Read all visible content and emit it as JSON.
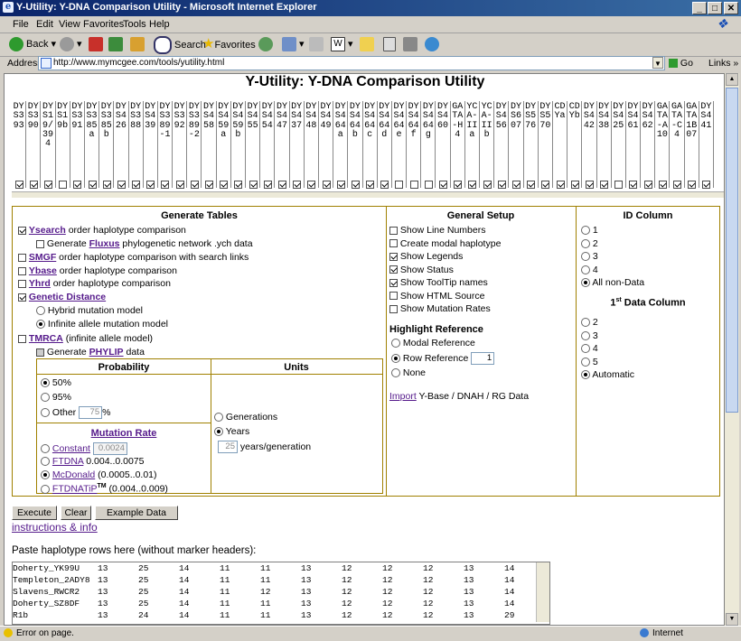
{
  "window": {
    "title": "Y-Utility: Y-DNA Comparison Utility - Microsoft Internet Explorer"
  },
  "menu": [
    "File",
    "Edit",
    "View",
    "Favorites",
    "Tools",
    "Help"
  ],
  "toolbar": {
    "back": "Back",
    "search": "Search",
    "favorites": "Favorites"
  },
  "address": {
    "label": "Address",
    "url": "http://www.mymcgee.com/tools/yutility.html",
    "go": "Go",
    "links": "Links"
  },
  "page": {
    "title": "Y-Utility: Y-DNA Comparison Utility"
  },
  "markers": [
    {
      "label": "DYS393",
      "on": true
    },
    {
      "label": "DYS390",
      "on": true
    },
    {
      "label": "DYS19/394",
      "on": true
    },
    {
      "label": "DYS19b",
      "on": false
    },
    {
      "label": "DYS391",
      "on": true
    },
    {
      "label": "DYS385a",
      "on": true
    },
    {
      "label": "DYS385b",
      "on": true
    },
    {
      "label": "DYS426",
      "on": true
    },
    {
      "label": "DYS388",
      "on": true
    },
    {
      "label": "DYS439",
      "on": true
    },
    {
      "label": "DYS389-1",
      "on": true
    },
    {
      "label": "DYS392",
      "on": true
    },
    {
      "label": "DYS389-2",
      "on": true
    },
    {
      "label": "DYS458",
      "on": true
    },
    {
      "label": "DYS459a",
      "on": true
    },
    {
      "label": "DYS459b",
      "on": true
    },
    {
      "label": "DYS455",
      "on": true
    },
    {
      "label": "DYS454",
      "on": true
    },
    {
      "label": "DYS447",
      "on": true
    },
    {
      "label": "DYS437",
      "on": true
    },
    {
      "label": "DYS448",
      "on": true
    },
    {
      "label": "DYS449",
      "on": true
    },
    {
      "label": "DYS464a",
      "on": true
    },
    {
      "label": "DYS464b",
      "on": true
    },
    {
      "label": "DYS464c",
      "on": true
    },
    {
      "label": "DYS464d",
      "on": true
    },
    {
      "label": "DYS464e",
      "on": false
    },
    {
      "label": "DYS464f",
      "on": false
    },
    {
      "label": "DYS464g",
      "on": false
    },
    {
      "label": "DYS460",
      "on": true
    },
    {
      "label": "GATA-H4",
      "on": true
    },
    {
      "label": "YCA-IIa",
      "on": true
    },
    {
      "label": "YCA-IIb",
      "on": true
    },
    {
      "label": "DYS456",
      "on": true
    },
    {
      "label": "DYS607",
      "on": true
    },
    {
      "label": "DYS576",
      "on": true
    },
    {
      "label": "DYS570",
      "on": true
    },
    {
      "label": "CDYa",
      "on": true
    },
    {
      "label": "CDYb",
      "on": true
    },
    {
      "label": "DYS442",
      "on": true
    },
    {
      "label": "DYS438",
      "on": true
    },
    {
      "label": "DYS425",
      "on": false
    },
    {
      "label": "DYS461",
      "on": true
    },
    {
      "label": "DYS462",
      "on": true
    },
    {
      "label": "GATA-A10",
      "on": true
    },
    {
      "label": "GATA-C4",
      "on": true
    },
    {
      "label": "GATA1B07",
      "on": true
    },
    {
      "label": "DYS441",
      "on": true
    }
  ],
  "generate": {
    "header": "Generate Tables",
    "ysearch": {
      "link": "Ysearch",
      "rest": " order haplotype comparison"
    },
    "fluxus": {
      "pre": "Generate ",
      "link": "Fluxus",
      "rest": " phylogenetic network .ych data"
    },
    "smgf": {
      "link": "SMGF",
      "rest": " order haplotype comparison with search links"
    },
    "ybase": {
      "link": "Ybase",
      "rest": " order haplotype comparison"
    },
    "yhrd": {
      "link": "Yhrd",
      "rest": " order haplotype comparison"
    },
    "gd": {
      "link": "Genetic Distance"
    },
    "hybrid": "Hybrid mutation model",
    "infinite": "Infinite allele mutation model",
    "tmrca": {
      "link": "TMRCA",
      "rest": " (infinite allele model)"
    },
    "phylip": {
      "pre": "Generate ",
      "link": "PHYLIP",
      "rest": " data"
    },
    "prob_header": "Probability",
    "units_header": "Units",
    "p50": "50%",
    "p95": "95%",
    "pother": "Other",
    "pother_val": "75",
    "pct": "%",
    "generations": "Generations",
    "years": "Years",
    "ypg_val": "25",
    "ypg": "years/generation",
    "mut_header": "Mutation Rate",
    "constant": "Constant",
    "constant_val": "0.0024",
    "ftdna": "FTDNA",
    "ftdna_rest": " 0.004..0.0075",
    "mcdonald": "McDonald",
    "mcdonald_rest": " (0.0005..0.01)",
    "ftdnatip": "FTDNATiP",
    "tm": "TM",
    "ftdnatip_rest": " (0.004..0.009)"
  },
  "setup": {
    "header": "General Setup",
    "items": [
      {
        "label": "Show Line Numbers",
        "on": false
      },
      {
        "label": "Create modal haplotype",
        "on": false
      },
      {
        "label": "Show Legends",
        "on": true
      },
      {
        "label": "Show Status",
        "on": true
      },
      {
        "label": "Show ToolTip names",
        "on": true
      },
      {
        "label": "Show HTML Source",
        "on": false
      },
      {
        "label": "Show Mutation Rates",
        "on": false
      }
    ],
    "hl_header": "Highlight Reference",
    "modal": "Modal Reference",
    "row": "Row Reference",
    "row_val": "1",
    "none": "None",
    "import_link": "Import",
    "import_rest": " Y-Base / DNAH / RG Data"
  },
  "idcol": {
    "header": "ID Column",
    "options": [
      "1",
      "2",
      "3",
      "4",
      "All non-Data"
    ],
    "data_header_sup": "st",
    "data_header_pre": "1",
    "data_header_rest": " Data Column",
    "data_options": [
      "2",
      "3",
      "4",
      "5",
      "Automatic"
    ]
  },
  "buttons": {
    "execute": "Execute",
    "clear": "Clear",
    "example": "Example Data"
  },
  "instructions": "instructions & info",
  "paste_label": "Paste haplotype rows here (without marker headers):",
  "rows": [
    [
      "Doherty_YK99U",
      "13",
      "25",
      "14",
      "11",
      "11",
      "13",
      "12",
      "12",
      "12",
      "13",
      "14"
    ],
    [
      "Templeton_2ADY8",
      "13",
      "25",
      "14",
      "11",
      "11",
      "13",
      "12",
      "12",
      "12",
      "13",
      "14"
    ],
    [
      "Slavens_RWCR2",
      "13",
      "25",
      "14",
      "11",
      "12",
      "13",
      "12",
      "12",
      "12",
      "13",
      "14"
    ],
    [
      "Doherty_SZ8DF",
      "13",
      "25",
      "14",
      "11",
      "11",
      "13",
      "12",
      "12",
      "12",
      "13",
      "14"
    ],
    [
      "R1b",
      "13",
      "24",
      "14",
      "11",
      "11",
      "13",
      "12",
      "12",
      "12",
      "13",
      "29"
    ]
  ],
  "status": {
    "left": "Error on page.",
    "right": "Internet"
  }
}
